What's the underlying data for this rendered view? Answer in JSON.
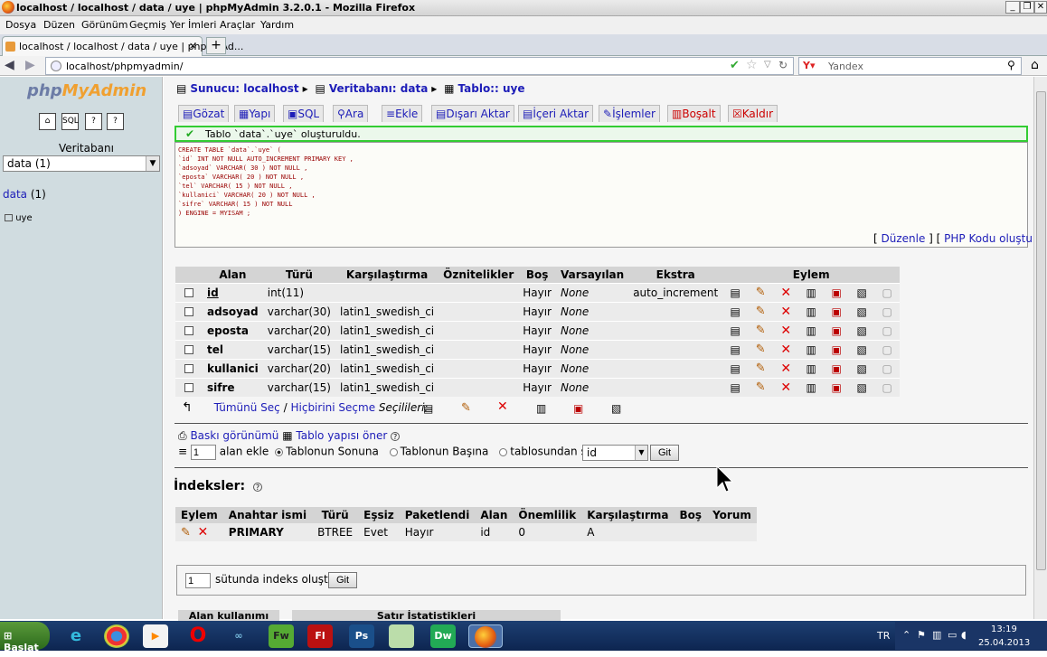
{
  "window": {
    "title": "localhost / localhost / data / uye | phpMyAdmin 3.2.0.1 - Mozilla Firefox"
  },
  "menu": [
    "Dosya",
    "Düzen",
    "Görünüm",
    "Geçmiş",
    "Yer İmleri",
    "Araçlar",
    "Yardım"
  ],
  "tab": {
    "label": "localhost / localhost / data / uye | phpMyAd...",
    "close": "×",
    "new": "+"
  },
  "nav": {
    "url": "localhost/phpmyadmin/",
    "search_placeholder": "Yandex"
  },
  "sidebar": {
    "logo_a": "php",
    "logo_b": "MyAdmin",
    "db_label": "Veritabanı",
    "db_select": "data (1)",
    "db_link": "data",
    "db_count": "(1)",
    "table": "uye"
  },
  "crumbs": {
    "server": "Sunucu: localhost",
    "db": "Veritabanı: data",
    "table": "Tablo:: uye"
  },
  "tabs": [
    "Gözat",
    "Yapı",
    "SQL",
    "Ara",
    "Ekle",
    "Dışarı Aktar",
    "İçeri Aktar",
    "İşlemler",
    "Boşalt",
    "Kaldır"
  ],
  "message": "Tablo `data`.`uye` oluşturuldu.",
  "sql_lines": [
    "CREATE TABLE `data`.`uye` (",
    "`id` INT NOT NULL AUTO_INCREMENT PRIMARY KEY ,",
    "`adsoyad` VARCHAR( 30 ) NOT NULL ,",
    "`eposta` VARCHAR( 20 ) NOT NULL ,",
    "`tel` VARCHAR( 15 ) NOT NULL ,",
    "`kullanici` VARCHAR( 20 ) NOT NULL ,",
    "`sifre` VARCHAR( 15 ) NOT NULL",
    ") ENGINE = MYISAM ;"
  ],
  "sql_links": {
    "edit": "Düzenle",
    "php": "PHP Kodu oluştur"
  },
  "structure": {
    "headers": [
      "Alan",
      "Türü",
      "Karşılaştırma",
      "Öznitelikler",
      "Boş",
      "Varsayılan",
      "Ekstra",
      "Eylem"
    ],
    "rows": [
      {
        "field": "id",
        "type": "int(11)",
        "collation": "",
        "attr": "",
        "null": "Hayır",
        "default": "None",
        "extra": "auto_increment"
      },
      {
        "field": "adsoyad",
        "type": "varchar(30)",
        "collation": "latin1_swedish_ci",
        "attr": "",
        "null": "Hayır",
        "default": "None",
        "extra": ""
      },
      {
        "field": "eposta",
        "type": "varchar(20)",
        "collation": "latin1_swedish_ci",
        "attr": "",
        "null": "Hayır",
        "default": "None",
        "extra": ""
      },
      {
        "field": "tel",
        "type": "varchar(15)",
        "collation": "latin1_swedish_ci",
        "attr": "",
        "null": "Hayır",
        "default": "None",
        "extra": ""
      },
      {
        "field": "kullanici",
        "type": "varchar(20)",
        "collation": "latin1_swedish_ci",
        "attr": "",
        "null": "Hayır",
        "default": "None",
        "extra": ""
      },
      {
        "field": "sifre",
        "type": "varchar(15)",
        "collation": "latin1_swedish_ci",
        "attr": "",
        "null": "Hayır",
        "default": "None",
        "extra": ""
      }
    ],
    "check_all": "Tümünü Seç",
    "sep": "/",
    "uncheck_all": "Hiçbirini Seçme",
    "with_selected": "Seçilileri:"
  },
  "tools": {
    "print_view": "Baskı görünümü",
    "propose": "Tablo yapısı öner",
    "add_count": "1",
    "add_label": "alan ekle",
    "opt_end": "Tablonun Sonuna",
    "opt_start": "Tablonun Başına",
    "opt_after": "tablosundan sonra",
    "after_field": "id",
    "go": "Git"
  },
  "indexes": {
    "title": "İndeksler:",
    "headers": [
      "Eylem",
      "Anahtar ismi",
      "Türü",
      "Eşsiz",
      "Paketlendi",
      "Alan",
      "Önemlilik",
      "Karşılaştırma",
      "Boş",
      "Yorum"
    ],
    "row": {
      "name": "PRIMARY",
      "type": "BTREE",
      "unique": "Evet",
      "packed": "Hayır",
      "field": "id",
      "card": "0",
      "collation": "A",
      "null": "",
      "comment": ""
    },
    "create_count": "1",
    "create_label": "sütunda indeks oluştur.",
    "go": "Git"
  },
  "bottom": {
    "space": "Alan kullanımı",
    "stats": "Satır İstatistikleri"
  },
  "taskbar": {
    "start": "Başlat",
    "lang": "TR",
    "time": "13:19",
    "date": "25.04.2013"
  }
}
